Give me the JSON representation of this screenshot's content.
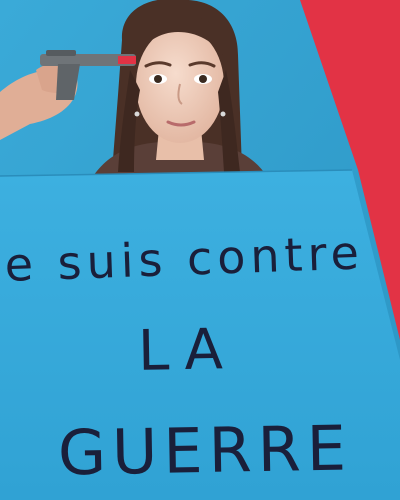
{
  "photo": {
    "background_color": "#2f9fd0",
    "accent_color": "#e23345",
    "sign_color": "#34a8da",
    "ink_color": "#1a1f3a"
  },
  "sign": {
    "line_1": "Je suis contre",
    "line_2": "LA",
    "line_3": "GUERRE"
  },
  "props": {
    "held_object": "toy-pistol-icon"
  }
}
